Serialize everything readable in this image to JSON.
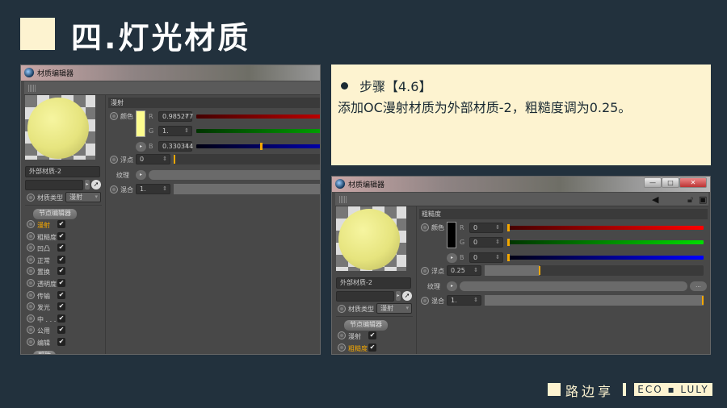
{
  "slide": {
    "title": "四.灯光材质",
    "step": "步骤【4.6】",
    "desc": "添加OC漫射材质为外部材质-2，粗糙度调为0.25。"
  },
  "footer": {
    "brand": "路边享",
    "tag": "ECO ▪ LULY"
  },
  "left_editor": {
    "window_title": "材质编辑器",
    "material_name": "外部材质-2",
    "material_type_label": "材质类型",
    "material_type": "漫射",
    "node_editor": "节点编辑器",
    "help": "帮助",
    "channels": [
      {
        "label": "漫射",
        "active": true,
        "checked": true
      },
      {
        "label": "粗糙度",
        "checked": true
      },
      {
        "label": "凹凸",
        "checked": true
      },
      {
        "label": "正常",
        "checked": true
      },
      {
        "label": "置换",
        "checked": true
      },
      {
        "label": "透明度",
        "checked": true
      },
      {
        "label": "传输",
        "checked": true
      },
      {
        "label": "发光",
        "checked": true
      },
      {
        "label": "中 . . .",
        "checked": true
      },
      {
        "label": "公用",
        "checked": true
      },
      {
        "label": "编辑",
        "checked": true
      }
    ],
    "section": "漫射",
    "color_label": "颜色",
    "swatch": "#fdfc8e",
    "r": "0.985277",
    "g": "1.",
    "b": "0.330344",
    "r_val": 0.985277,
    "g_val": 1,
    "b_val": 0.330344,
    "float_label": "浮点",
    "float": "0",
    "float_val": 0,
    "texture_label": "纹理",
    "mix_label": "混合",
    "mix": "1.",
    "mix_val": 1
  },
  "right_editor": {
    "window_title": "材质编辑器",
    "material_name": "外部材质-2",
    "material_type_label": "材质类型",
    "material_type": "漫射",
    "node_editor": "节点编辑器",
    "channels": [
      {
        "label": "漫射",
        "checked": true
      },
      {
        "label": "粗糙度",
        "active": true,
        "checked": true
      }
    ],
    "section": "粗糙度",
    "color_label": "颜色",
    "swatch": "#000000",
    "r": "0",
    "g": "0",
    "b": "0",
    "r_val": 0,
    "g_val": 0,
    "b_val": 0,
    "float_label": "浮点",
    "float": "0.25",
    "float_val": 0.25,
    "texture_label": "纹理",
    "texture_more": "...",
    "mix_label": "混合",
    "mix": "1.",
    "mix_val": 1
  },
  "colors": {
    "background": "#22313d",
    "accent": "#fdf3d0",
    "active_channel": "#f5a800"
  }
}
